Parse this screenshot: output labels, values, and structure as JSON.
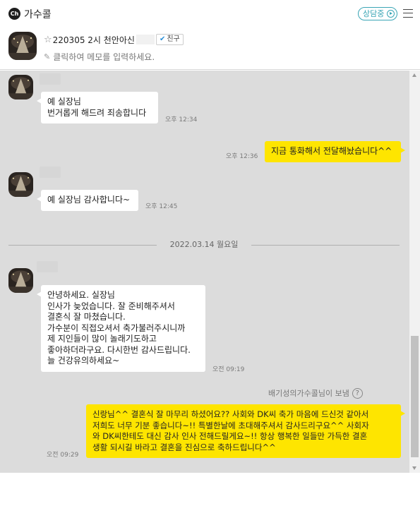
{
  "app": {
    "logo_text": "Ch",
    "name": "가수콜",
    "status_label": "상담중"
  },
  "profile": {
    "name": "220305 2시 천안아신",
    "friend_label": "친구",
    "memo_placeholder": "클릭하여 메모를 입력하세요."
  },
  "icons": {
    "star": "☆",
    "check": "✔",
    "pencil": "✎",
    "help": "?"
  },
  "messages": [
    {
      "direction": "in",
      "text": "예 실장님\n번거롭게 해드려 죄송합니다",
      "time": "오후 12:34"
    },
    {
      "direction": "out",
      "text": "지금 통화해서 전달해놨습니다^^",
      "time": "오후 12:36"
    },
    {
      "direction": "in",
      "text": "예 실장님 감사합니다~",
      "time": "오후 12:45"
    },
    {
      "direction": "in",
      "text": "안녕하세요. 실장님\n인사가 늦었습니다. 잘 준비해주셔서\n결혼식 잘 마쳤습니다.\n가수분이 직접오셔서 축가불러주시니까\n제 지인들이 많이 놀래기도하고\n좋아하더라구요. 다시한번 감사드립니다.\n늘 건강유의하세요~",
      "time": "오전 09:19"
    },
    {
      "direction": "out",
      "text": "신랑님^^ 결혼식 잘 마무리 하셨어요?? 사회와 DK씨 축가 마음에 드신것 같아서\n저희도 너무 기분 좋습니다~!! 특별한날에 초대해주셔서 감사드리구요^^ 사회자\n와 DK씨한테도 대신 감사 인사 전해드릴게요~!! 항상 행복한 일들만 가득한 결혼\n생활 되시길 바라고 결혼을 진심으로 축하드립니다^^",
      "time": "오전 09:29"
    }
  ],
  "date_separator": "2022.03.14 월요일",
  "sent_by": "배기성의가수콜님이 보냄"
}
